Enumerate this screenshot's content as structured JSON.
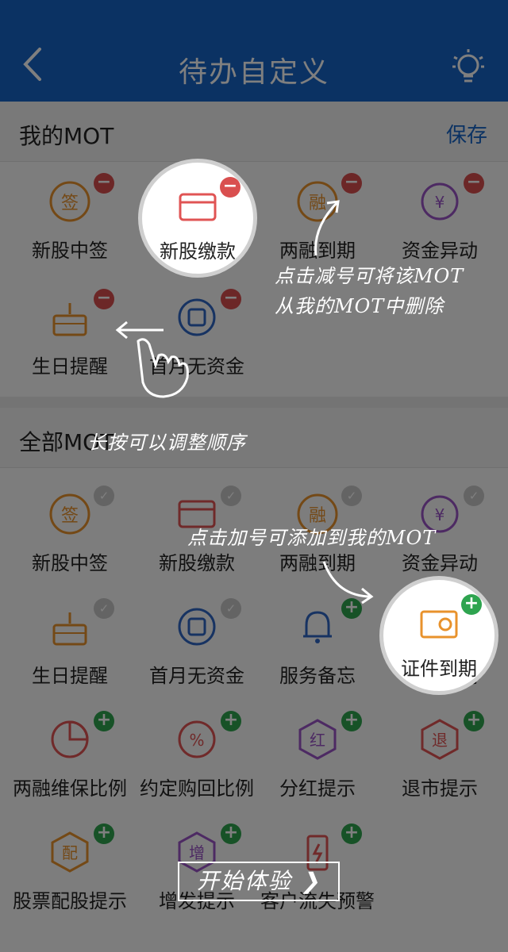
{
  "header": {
    "title": "待办自定义"
  },
  "my_section": {
    "title": "我的MOT",
    "save_label": "保存"
  },
  "my_items": [
    {
      "label": "新股中签",
      "icon": "sign-icon"
    },
    {
      "label": "新股缴款",
      "icon": "payment-card-icon"
    },
    {
      "label": "两融到期",
      "icon": "margin-icon"
    },
    {
      "label": "资金异动",
      "icon": "yuan-cycle-icon"
    },
    {
      "label": "生日提醒",
      "icon": "birthday-cake-icon"
    },
    {
      "label": "首月无资金",
      "icon": "wallet-icon"
    }
  ],
  "all_section": {
    "title": "全部MOT"
  },
  "all_items": [
    {
      "label": "新股中签",
      "icon": "sign-icon",
      "status": "added"
    },
    {
      "label": "新股缴款",
      "icon": "payment-card-icon",
      "status": "added"
    },
    {
      "label": "两融到期",
      "icon": "margin-icon",
      "status": "added"
    },
    {
      "label": "资金异动",
      "icon": "yuan-cycle-icon",
      "status": "added"
    },
    {
      "label": "生日提醒",
      "icon": "birthday-cake-icon",
      "status": "added"
    },
    {
      "label": "首月无资金",
      "icon": "wallet-icon",
      "status": "added"
    },
    {
      "label": "服务备忘",
      "icon": "bell-icon",
      "status": "addable"
    },
    {
      "label": "证件到期",
      "icon": "id-card-icon",
      "status": "addable"
    },
    {
      "label": "两融维保比例",
      "icon": "pie-chart-icon",
      "status": "addable"
    },
    {
      "label": "约定购回比例",
      "icon": "percent-icon",
      "status": "addable"
    },
    {
      "label": "分红提示",
      "icon": "dividend-icon",
      "status": "addable"
    },
    {
      "label": "退市提示",
      "icon": "delist-icon",
      "status": "addable"
    },
    {
      "label": "股票配股提示",
      "icon": "allotment-icon",
      "status": "addable"
    },
    {
      "label": "增发提示",
      "icon": "additional-issue-icon",
      "status": "addable"
    },
    {
      "label": "客户流失预警",
      "icon": "battery-alert-icon",
      "status": "addable"
    }
  ],
  "guide": {
    "delete_hint_line1": "点击减号可将该MOT",
    "delete_hint_line2": "从我的MOT中删除",
    "reorder_hint": "长按可以调整顺序",
    "add_hint": "点击加号可添加到我的MOT",
    "start_label": "开始体验 ❯"
  },
  "colors": {
    "header": "#1765c7",
    "icon_orange": "#e8922c",
    "icon_red": "#e05454",
    "icon_purple": "#9a55c7",
    "icon_blue": "#2f67c5",
    "minus_badge": "#d94f4f",
    "plus_badge": "#2ea44f"
  }
}
